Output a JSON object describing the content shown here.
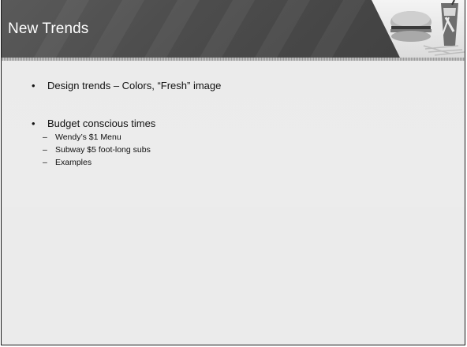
{
  "slide": {
    "title": "New Trends",
    "bullets": [
      {
        "text": "Design trends – Colors, “Fresh” image",
        "subitems": []
      },
      {
        "text": "Budget conscious times",
        "subitems": [
          "Wendy’s $1 Menu",
          "Subway $5 foot-long subs",
          "Examples"
        ]
      }
    ],
    "bullet_glyph": "•",
    "dash_glyph": "–"
  },
  "colors": {
    "header_bg": "#4c4c4c",
    "slide_bg": "#ebebeb",
    "text": "#111111"
  },
  "icons": [
    "fast-food-photo"
  ]
}
